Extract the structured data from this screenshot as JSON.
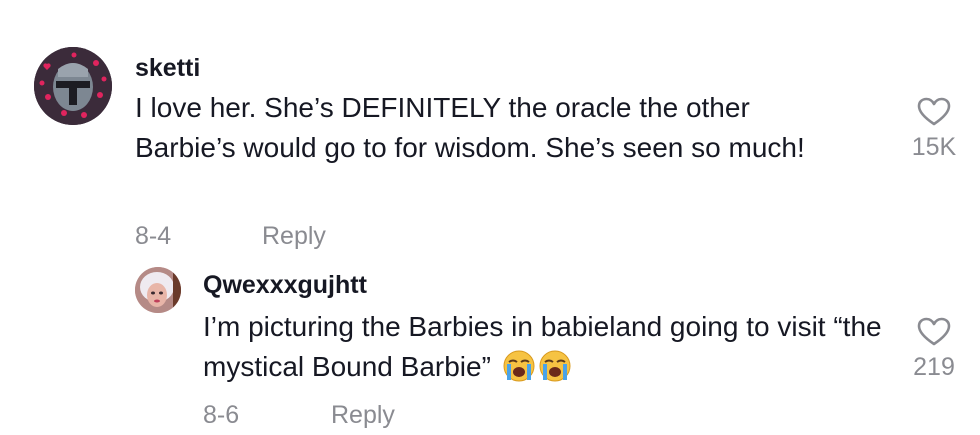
{
  "comments": [
    {
      "username": "sketti",
      "text": "I love her. She’s DEFINITELY the oracle the other Barbie’s would go to for wisdom. She’s seen so much!",
      "date": "8-4",
      "reply_label": "Reply",
      "like_count": "15K",
      "avatar_icon": "helmet-avatar-with-hearts"
    }
  ],
  "replies": [
    {
      "username": "Qwexxxgujhtt",
      "text": "I’m picturing the Barbies in babieland going to visit “the mystical Bound Barbie”",
      "emojis": [
        "loudly-crying-face-icon",
        "loudly-crying-face-icon"
      ],
      "date": "8-6",
      "reply_label": "Reply",
      "like_count": "219",
      "avatar_icon": "doll-avatar"
    }
  ],
  "colors": {
    "text": "#161823",
    "muted": "#8a8b91",
    "heart": "#8a8b91"
  }
}
